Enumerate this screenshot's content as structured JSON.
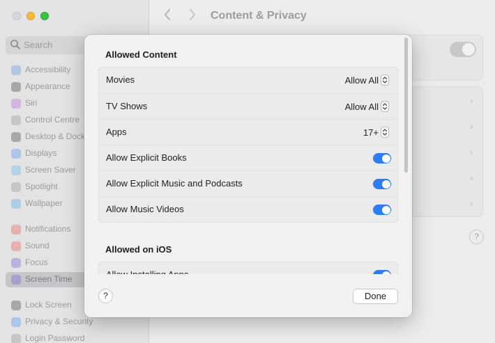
{
  "window": {
    "title": "Content & Privacy",
    "back_icon": "chevron-left-icon",
    "forward_icon": "chevron-right-icon"
  },
  "sidebar": {
    "search_placeholder": "Search",
    "items": [
      {
        "label": "Accessibility",
        "icon": "accessibility-icon",
        "color": "#5a8fe0"
      },
      {
        "label": "Appearance",
        "icon": "appearance-icon",
        "color": "#3a3a3a"
      },
      {
        "label": "Siri",
        "icon": "siri-icon",
        "color": "#b062d6"
      },
      {
        "label": "Control Centre",
        "icon": "control-centre-icon",
        "color": "#8e8e93"
      },
      {
        "label": "Desktop & Dock",
        "icon": "desktop-dock-icon",
        "color": "#3a3a3a"
      },
      {
        "label": "Displays",
        "icon": "displays-icon",
        "color": "#4b8cf0"
      },
      {
        "label": "Screen Saver",
        "icon": "screen-saver-icon",
        "color": "#55b8e6"
      },
      {
        "label": "Spotlight",
        "icon": "spotlight-icon",
        "color": "#8e8e93"
      },
      {
        "label": "Wallpaper",
        "icon": "wallpaper-icon",
        "color": "#46a6e8"
      },
      {
        "label": "Notifications",
        "icon": "notifications-icon",
        "color": "#e8564e"
      },
      {
        "label": "Sound",
        "icon": "sound-icon",
        "color": "#e8564e"
      },
      {
        "label": "Focus",
        "icon": "focus-icon",
        "color": "#6a5ad8"
      },
      {
        "label": "Screen Time",
        "icon": "screen-time-icon",
        "color": "#6a5ad8",
        "selected": true
      },
      {
        "label": "Lock Screen",
        "icon": "lock-screen-icon",
        "color": "#3a3a3a"
      },
      {
        "label": "Privacy & Security",
        "icon": "privacy-security-icon",
        "color": "#4b8cf0"
      },
      {
        "label": "Login Password",
        "icon": "login-password-icon",
        "color": "#8e8e93"
      }
    ]
  },
  "sheet": {
    "allowed_content": {
      "title": "Allowed Content",
      "rows": [
        {
          "label": "Movies",
          "type": "popup",
          "value": "Allow All"
        },
        {
          "label": "TV Shows",
          "type": "popup",
          "value": "Allow All"
        },
        {
          "label": "Apps",
          "type": "popup",
          "value": "17+"
        },
        {
          "label": "Allow Explicit Books",
          "type": "toggle",
          "on": true
        },
        {
          "label": "Allow Explicit Music and Podcasts",
          "type": "toggle",
          "on": true
        },
        {
          "label": "Allow Music Videos",
          "type": "toggle",
          "on": true
        }
      ]
    },
    "allowed_on_ios": {
      "title": "Allowed on iOS",
      "rows": [
        {
          "label": "Allow Installing Apps",
          "type": "toggle",
          "on": true
        }
      ]
    },
    "footer": {
      "help_label": "?",
      "done_label": "Done"
    }
  },
  "background": {
    "help_label": "?"
  },
  "colors": {
    "accent": "#2c7df6"
  }
}
